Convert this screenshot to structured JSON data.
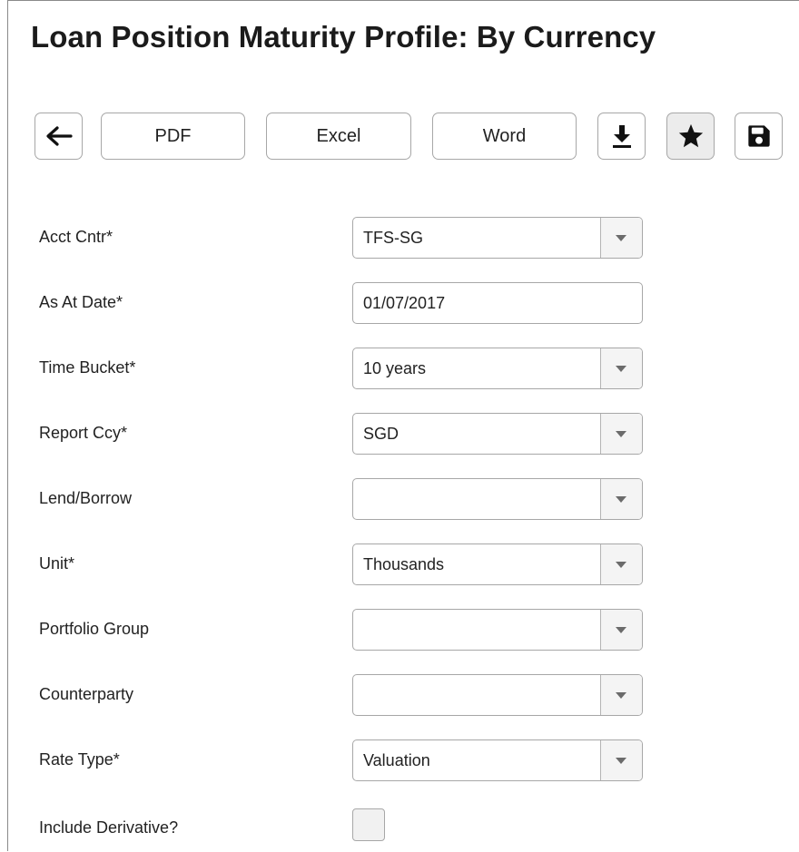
{
  "page": {
    "title": "Loan Position Maturity Profile: By Currency"
  },
  "toolbar": {
    "back_icon": "arrow-left-icon",
    "pdf_label": "PDF",
    "excel_label": "Excel",
    "word_label": "Word",
    "download_icon": "download-icon",
    "favorite_icon": "star-icon",
    "save_icon": "floppy-disk-icon"
  },
  "form": {
    "acct_cntr": {
      "label": "Acct Cntr*",
      "value": "TFS-SG"
    },
    "as_at_date": {
      "label": "As At Date*",
      "value": "01/07/2017"
    },
    "time_bucket": {
      "label": "Time Bucket*",
      "value": "10 years"
    },
    "report_ccy": {
      "label": "Report Ccy*",
      "value": "SGD"
    },
    "lend_borrow": {
      "label": "Lend/Borrow",
      "value": ""
    },
    "unit": {
      "label": "Unit*",
      "value": "Thousands"
    },
    "portfolio_group": {
      "label": "Portfolio Group",
      "value": ""
    },
    "counterparty": {
      "label": "Counterparty",
      "value": ""
    },
    "rate_type": {
      "label": "Rate Type*",
      "value": "Valuation"
    },
    "include_derivative": {
      "label": "Include Derivative?",
      "checked": false
    }
  }
}
